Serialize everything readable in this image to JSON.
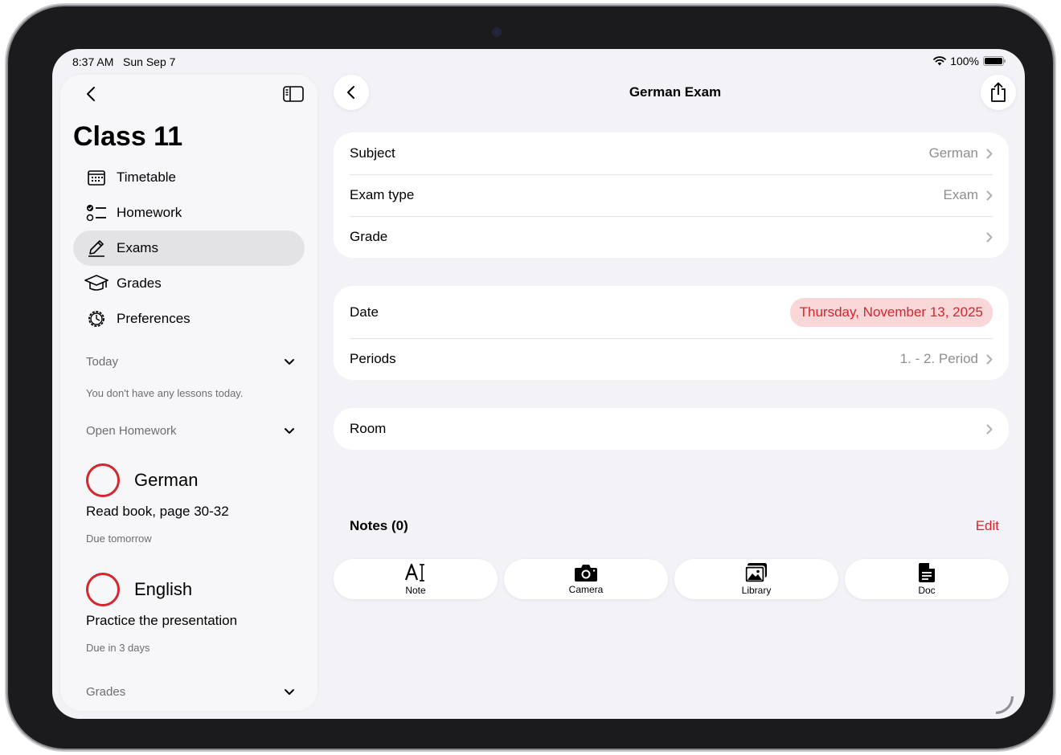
{
  "status": {
    "time": "8:37 AM",
    "date": "Sun Sep 7",
    "battery": "100%"
  },
  "sidebar": {
    "title": "Class 11",
    "nav": [
      {
        "label": "Timetable",
        "icon": "calendar-icon",
        "active": false
      },
      {
        "label": "Homework",
        "icon": "checklist-icon",
        "active": false
      },
      {
        "label": "Exams",
        "icon": "pencil-icon",
        "active": true
      },
      {
        "label": "Grades",
        "icon": "graduation-cap-icon",
        "active": false
      },
      {
        "label": "Preferences",
        "icon": "gear-icon",
        "active": false
      }
    ],
    "today": {
      "label": "Today",
      "empty": "You don't have any lessons today."
    },
    "open_homework": {
      "label": "Open Homework",
      "items": [
        {
          "subject": "German",
          "task": "Read book, page 30-32",
          "due": "Due tomorrow"
        },
        {
          "subject": "English",
          "task": "Practice the presentation",
          "due": "Due in 3 days"
        }
      ]
    },
    "grades": {
      "label": "Grades"
    }
  },
  "detail": {
    "title": "German Exam",
    "card1": [
      {
        "label": "Subject",
        "value": "German"
      },
      {
        "label": "Exam type",
        "value": "Exam"
      },
      {
        "label": "Grade",
        "value": ""
      }
    ],
    "card2": {
      "date_label": "Date",
      "date_value": "Thursday, November 13, 2025",
      "periods_label": "Periods",
      "periods_value": "1. - 2. Period"
    },
    "room_label": "Room",
    "notes": {
      "title": "Notes (0)",
      "edit": "Edit"
    },
    "attachments": [
      {
        "label": "Note",
        "icon": "text-cursor-icon"
      },
      {
        "label": "Camera",
        "icon": "camera-icon"
      },
      {
        "label": "Library",
        "icon": "photo-library-icon"
      },
      {
        "label": "Doc",
        "icon": "document-icon"
      }
    ]
  },
  "colors": {
    "accent": "#d4262e",
    "accent_bg": "#f9d6d7",
    "background": "#f2f2f7"
  }
}
